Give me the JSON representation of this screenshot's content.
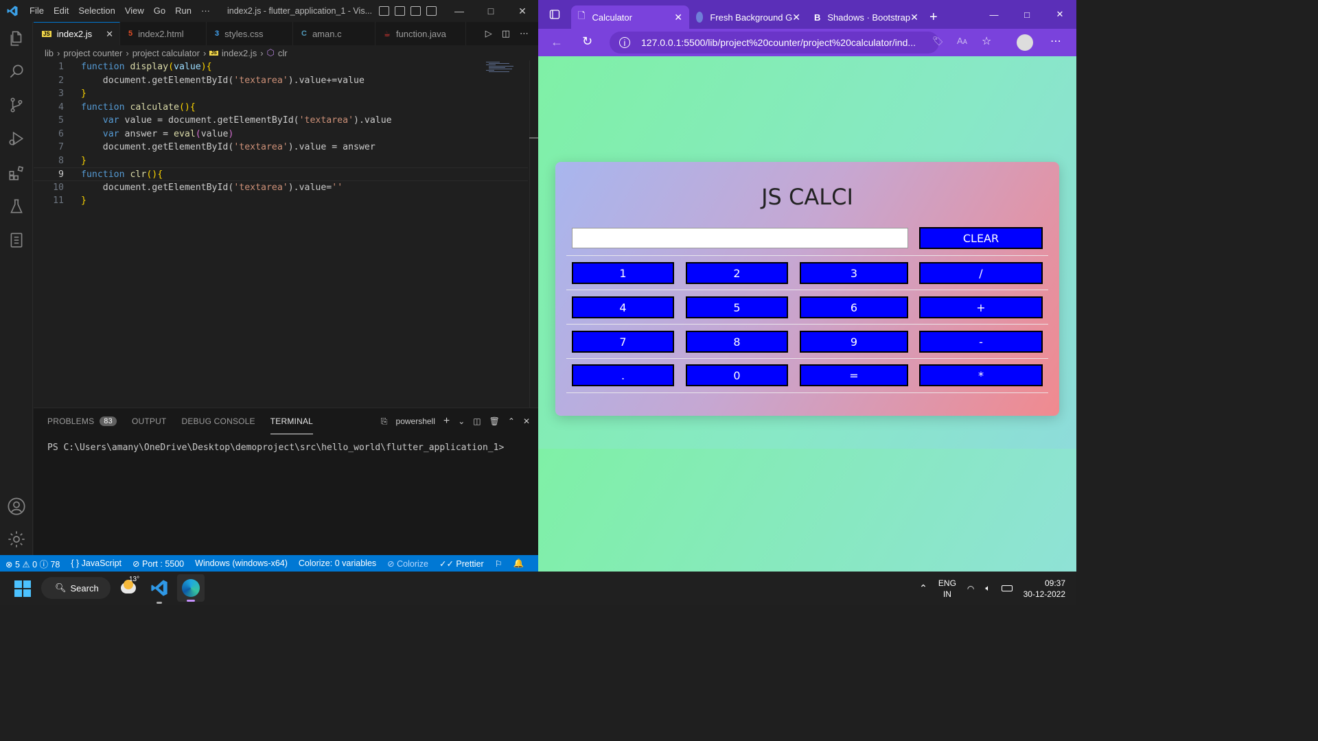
{
  "vscode": {
    "title": "index2.js - flutter_application_1 - Vis...",
    "menu": [
      "File",
      "Edit",
      "Selection",
      "View",
      "Go",
      "Run",
      "···"
    ],
    "tabs": [
      {
        "icon": "JS",
        "label": "index2.js",
        "icon_color": "#f1d64a"
      },
      {
        "icon": "5",
        "label": "index2.html",
        "icon_color": "#e44d26"
      },
      {
        "icon": "3",
        "label": "styles.css",
        "icon_color": "#42a5f5"
      },
      {
        "icon": "C",
        "label": "aman.c",
        "icon_color": "#519aba"
      },
      {
        "icon": "☕",
        "label": "function.java",
        "icon_color": "#e53935"
      }
    ],
    "breadcrumb": [
      "lib",
      "project counter",
      "project calculator",
      "index2.js",
      "clr"
    ],
    "code_lines": [
      "1",
      "2",
      "3",
      "4",
      "5",
      "6",
      "7",
      "8",
      "9",
      "10",
      "11"
    ],
    "code": {
      "l1_kw": "function",
      "l1_fn": "display",
      "l1_rest": "value",
      "l2": "document.getElementById(",
      "l2_str": "'textarea'",
      "l2_rest": ").value+=value",
      "l4_kw": "function",
      "l4_fn": "calculate",
      "l5_var": "var",
      "l5_a": " value = document.getElementById(",
      "l5_str": "'textarea'",
      "l5_b": ").value",
      "l6_var": "var",
      "l6_a": " answer = ",
      "l6_fn": "eval",
      "l6_b": "value",
      "l7_a": "document.getElementById(",
      "l7_str": "'textarea'",
      "l7_b": ").value = answer",
      "l9_kw": "function",
      "l9_fn": "clr",
      "l10_a": "document.getElementById(",
      "l10_str": "'textarea'",
      "l10_b": ").value=",
      "l10_str2": "''"
    },
    "panel": {
      "tabs": [
        "PROBLEMS",
        "OUTPUT",
        "DEBUG CONSOLE",
        "TERMINAL"
      ],
      "problems_count": "83",
      "shell": "powershell",
      "terminal_text": "PS C:\\Users\\amany\\OneDrive\\Desktop\\demoproject\\src\\hello_world\\flutter_application_1>"
    },
    "status": {
      "errors": "5",
      "warnings": "0",
      "info": "78",
      "language": "JavaScript",
      "port": "Port : 5500",
      "platform": "Windows (windows-x64)",
      "colorize_vars": "Colorize: 0 variables",
      "colorize": "Colorize",
      "prettier": "Prettier"
    }
  },
  "edge": {
    "tabs": [
      {
        "label": "Calculator"
      },
      {
        "label": "Fresh Background G"
      },
      {
        "label": "Shadows · Bootstrap"
      }
    ],
    "url": "127.0.0.1:5500/lib/project%20counter/project%20calculator/ind...",
    "calc": {
      "title": "JS CALCI",
      "clear": "CLEAR",
      "rows": [
        [
          "1",
          "2",
          "3",
          "/"
        ],
        [
          "4",
          "5",
          "6",
          "+"
        ],
        [
          "7",
          "8",
          "9",
          "-"
        ],
        [
          ".",
          "0",
          "=",
          "*"
        ]
      ]
    }
  },
  "taskbar": {
    "search": "Search",
    "weather": "13°",
    "lang_top": "ENG",
    "lang_bottom": "IN",
    "time": "09:37",
    "date": "30-12-2022"
  },
  "colors": {
    "vscode_accent": "#0078d4",
    "edge_purple": "#7a42dc",
    "calc_button": "#0000ff"
  }
}
